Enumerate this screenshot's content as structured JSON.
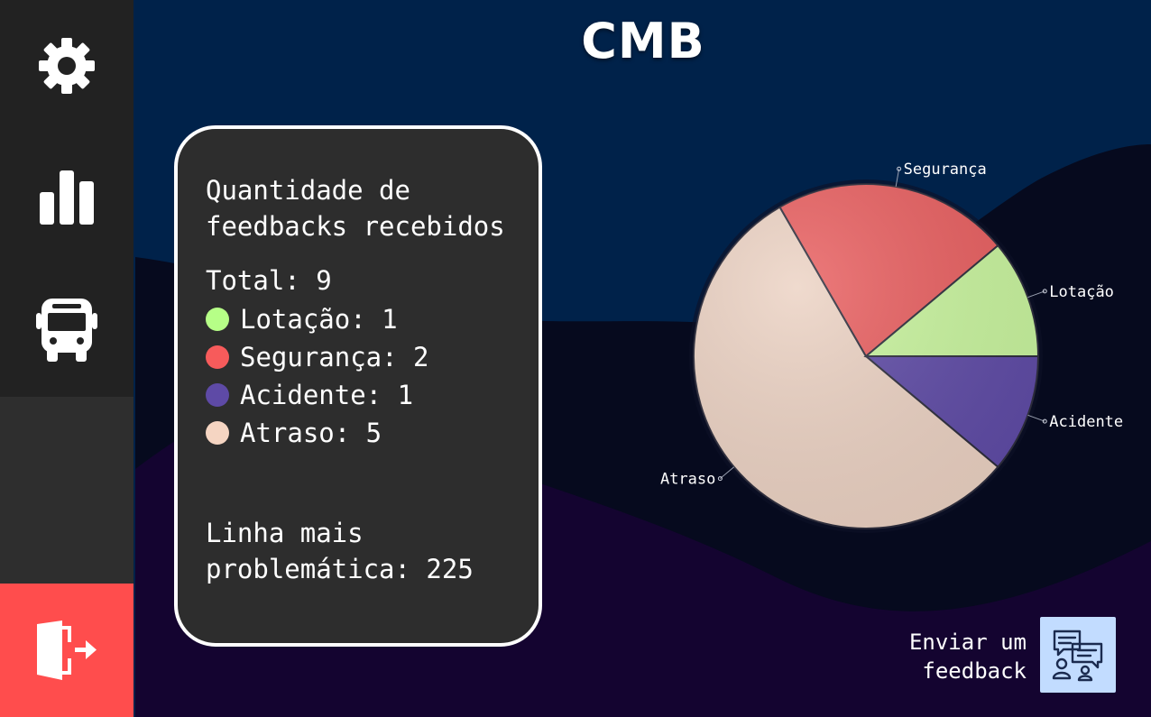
{
  "colors": {
    "sidebar_dark": "#222222",
    "sidebar_mid": "#2e2e2e",
    "logout_red": "#ff4d4d",
    "bg_top": "#00224a",
    "bg_mid": "#060a1e",
    "bg_bottom": "#160530",
    "card_bg": "#2d2d2d",
    "feedback_button_bg": "#c2dcff"
  },
  "sidebar": {
    "items": [
      {
        "icon": "gear-icon"
      },
      {
        "icon": "bar-chart-icon"
      },
      {
        "icon": "bus-icon"
      }
    ],
    "logout": {
      "icon": "door-exit-icon"
    }
  },
  "header": {
    "title": "CMB"
  },
  "summary": {
    "title": "Quantidade de feedbacks recebidos",
    "total_label": "Total: 9",
    "items": [
      {
        "label": "Lotação: 1",
        "color": "#b6ff87"
      },
      {
        "label": "Segurança: 2",
        "color": "#f75b5b"
      },
      {
        "label": "Acidente: 1",
        "color": "#5e4aa6"
      },
      {
        "label": "Atraso: 5",
        "color": "#f5d5c2"
      }
    ],
    "line_label": "Linha mais problemática: 225"
  },
  "chart_data": {
    "type": "pie",
    "categories": [
      "Acidente",
      "Atraso",
      "Segurança",
      "Lotação"
    ],
    "values": [
      1,
      5,
      2,
      1
    ],
    "colors": [
      "#5e4aa6",
      "#ecd2c3",
      "#e95e5f",
      "#c9f59e"
    ],
    "legend": "none"
  },
  "feedback": {
    "label": "Enviar um feedback",
    "icon": "chat-people-icon"
  }
}
